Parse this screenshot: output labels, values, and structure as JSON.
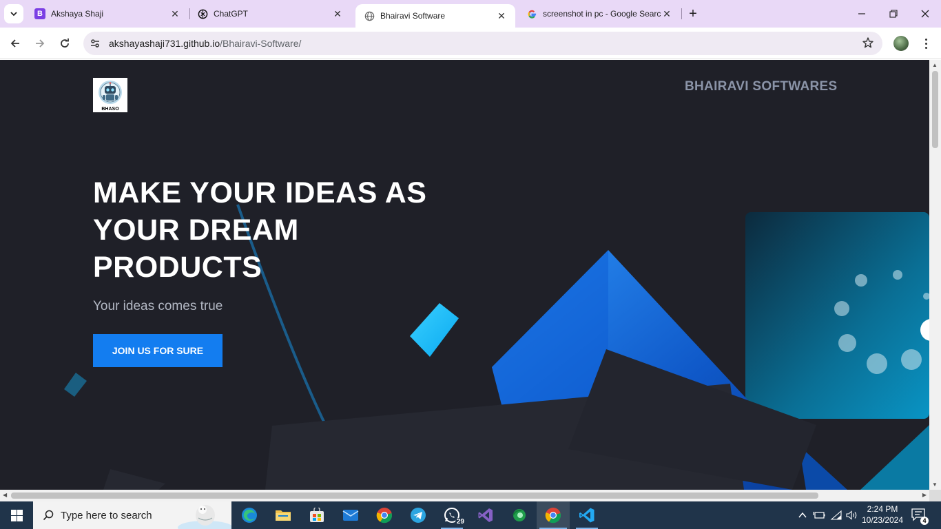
{
  "browser": {
    "tabs": [
      {
        "title": "Akshaya Shaji",
        "favicon_letter": "B",
        "favicon_color": "#7b3fe4"
      },
      {
        "title": "ChatGPT",
        "favicon_icon": "openai-icon"
      },
      {
        "title": "Bhairavi Software",
        "favicon_icon": "globe-icon",
        "active": true
      },
      {
        "title": "screenshot in pc - Google Search",
        "favicon_icon": "google-icon"
      }
    ],
    "url_host": "akshayashaji731.github.io",
    "url_path": "/Bhairavi-Software/"
  },
  "page": {
    "logo_text": "BHASO",
    "brand": "BHAIRAVI SOFTWARES",
    "hero_title": "MAKE YOUR IDEAS AS YOUR DREAM PRODUCTS",
    "hero_subtitle": "Your ideas comes true",
    "cta_label": "JOIN US FOR SURE",
    "background_color": "#1f2028",
    "accent_color": "#137df0"
  },
  "taskbar": {
    "search_placeholder": "Type here to search",
    "pinned": [
      "edge-icon",
      "file-explorer-icon",
      "microsoft-store-icon",
      "mail-icon",
      "chrome-icon",
      "telegram-icon",
      "whatsapp-icon",
      "visual-studio-icon",
      "green-app-icon",
      "chrome-icon",
      "vscode-icon"
    ],
    "whatsapp_badge": "29",
    "time": "2:24 PM",
    "date": "10/23/2024",
    "notification_count": "4"
  }
}
